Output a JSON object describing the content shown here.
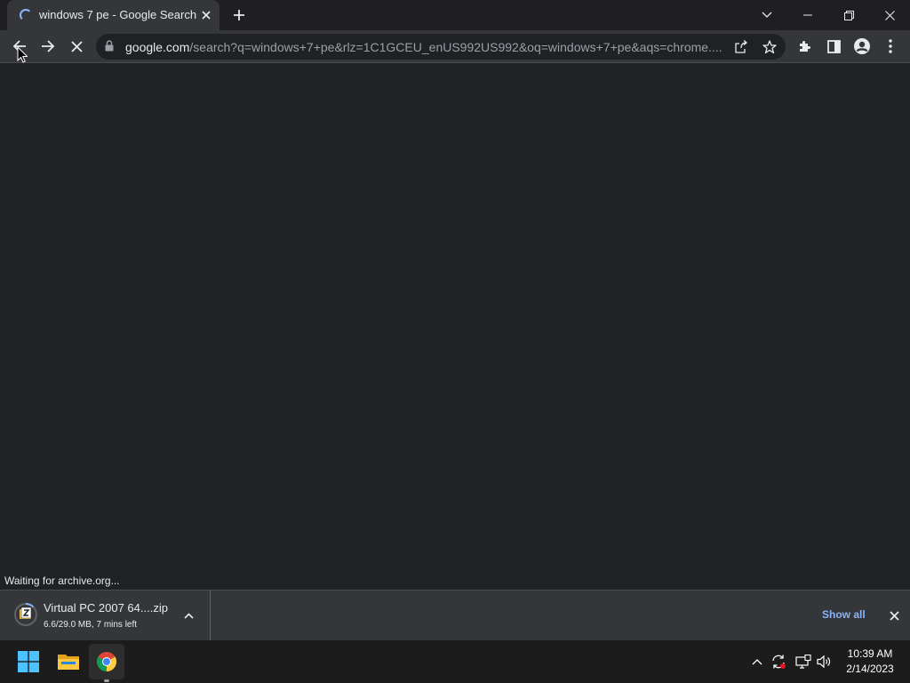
{
  "window": {
    "tab_title": "windows 7 pe - Google Search"
  },
  "toolbar": {
    "url_host": "google.com",
    "url_path": "/search?q=windows+7+pe&rlz=1C1GCEU_enUS992US992&oq=windows+7+pe&aqs=chrome...."
  },
  "status_text": "Waiting for archive.org...",
  "download": {
    "filename": "Virtual PC 2007 64....zip",
    "progress": "6.6/29.0 MB, 7 mins left",
    "show_all": "Show all"
  },
  "taskbar": {
    "time": "10:39 AM",
    "date": "2/14/2023"
  },
  "colors": {
    "accent": "#8ab4f8",
    "frame": "#1f1f21",
    "toolbar": "#35363a",
    "page": "#202124"
  }
}
